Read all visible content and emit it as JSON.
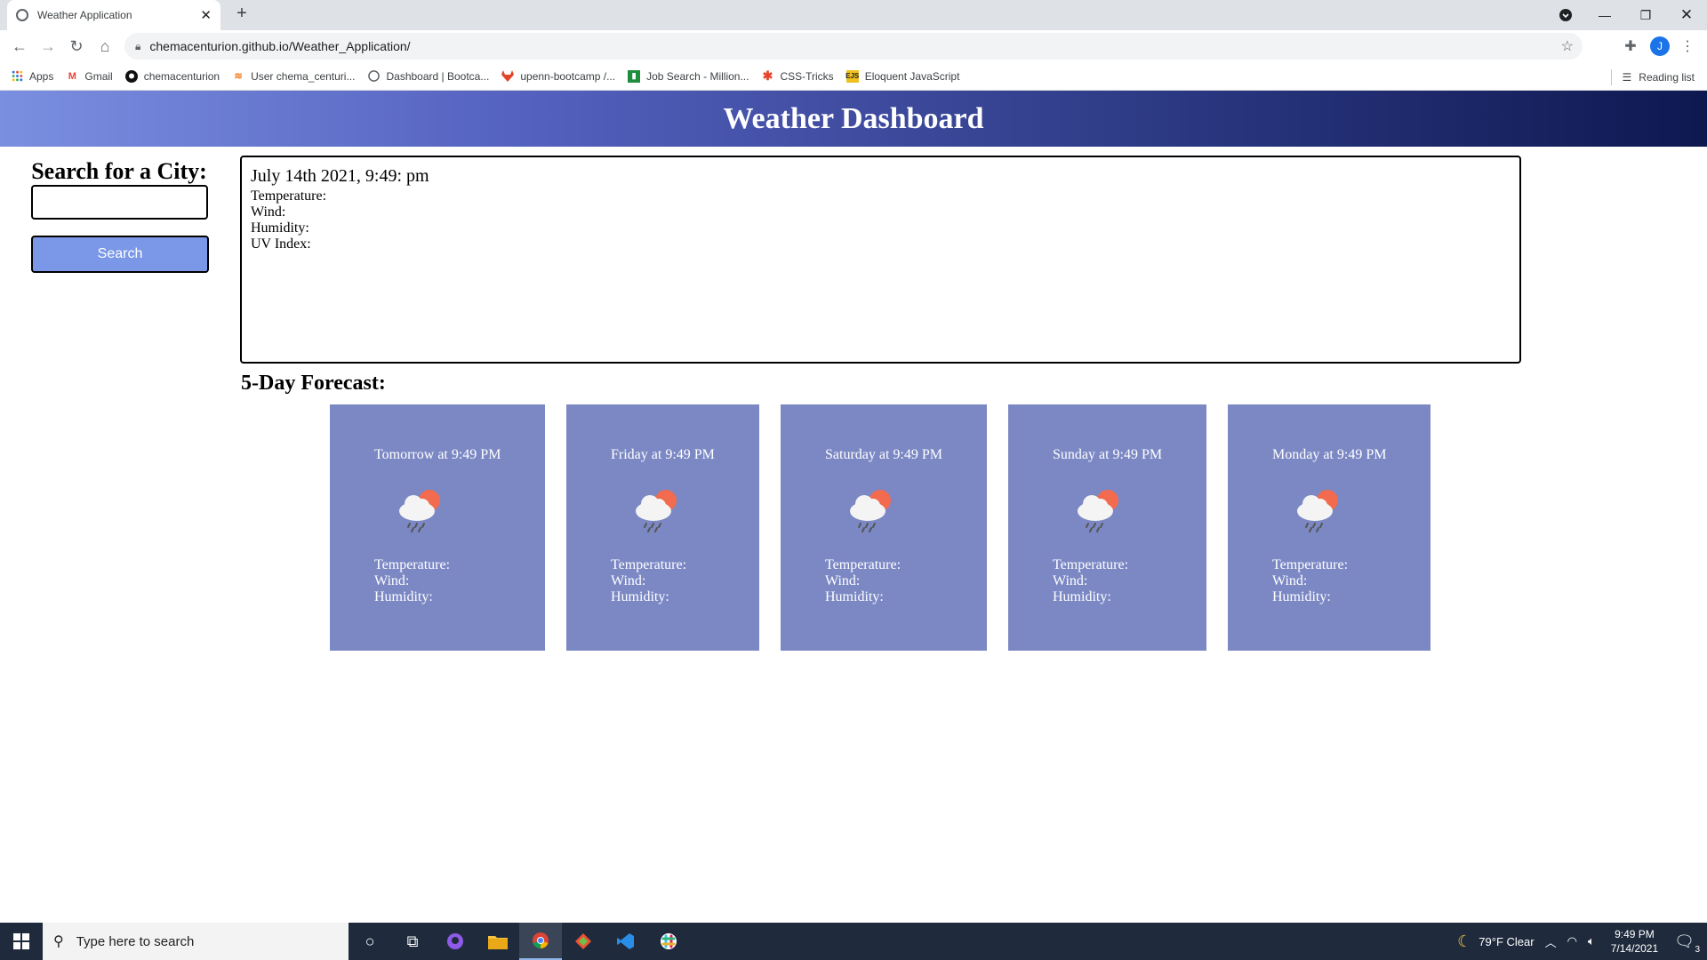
{
  "browser": {
    "tab_title": "Weather Application",
    "url": "chemacenturion.github.io/Weather_Application/",
    "profile_initial": "J",
    "bookmarks": [
      {
        "icon": "apps-grid-icon",
        "label": "Apps"
      },
      {
        "icon": "gmail-icon",
        "label": "Gmail"
      },
      {
        "icon": "github-icon",
        "label": "chemacenturion"
      },
      {
        "icon": "stackoverflow-icon",
        "label": "User chema_centuri..."
      },
      {
        "icon": "globe-icon",
        "label": "Dashboard | Bootca..."
      },
      {
        "icon": "gitlab-icon",
        "label": "upenn-bootcamp /..."
      },
      {
        "icon": "job-search-icon",
        "label": "Job Search - Million..."
      },
      {
        "icon": "css-tricks-icon",
        "label": "CSS-Tricks"
      },
      {
        "icon": "ejs-icon",
        "label": "Eloquent JavaScript"
      }
    ],
    "reading_list": "Reading list"
  },
  "page": {
    "title": "Weather Dashboard",
    "search_title": "Search for a City:",
    "search_input_value": "",
    "search_button": "Search",
    "current": {
      "date": "July 14th 2021, 9:49: pm",
      "temperature_label": "Temperature:",
      "wind_label": "Wind:",
      "humidity_label": "Humidity:",
      "uv_label": "UV Index:"
    },
    "forecast_title": "5-Day Forecast:",
    "forecast": [
      {
        "day": "Tomorrow at 9:49 PM",
        "icon": "cloud-rain-sun-icon",
        "temperature": "Temperature:",
        "wind": "Wind:",
        "humidity": "Humidity:"
      },
      {
        "day": "Friday at 9:49 PM",
        "icon": "cloud-rain-sun-icon",
        "temperature": "Temperature:",
        "wind": "Wind:",
        "humidity": "Humidity:"
      },
      {
        "day": "Saturday at 9:49 PM",
        "icon": "cloud-rain-sun-icon",
        "temperature": "Temperature:",
        "wind": "Wind:",
        "humidity": "Humidity:"
      },
      {
        "day": "Sunday at 9:49 PM",
        "icon": "cloud-rain-sun-icon",
        "temperature": "Temperature:",
        "wind": "Wind:",
        "humidity": "Humidity:"
      },
      {
        "day": "Monday at 9:49 PM",
        "icon": "cloud-rain-sun-icon",
        "temperature": "Temperature:",
        "wind": "Wind:",
        "humidity": "Humidity:"
      }
    ]
  },
  "taskbar": {
    "search_placeholder": "Type here to search",
    "weather": "79°F  Clear",
    "time": "9:49 PM",
    "date": "7/14/2021",
    "notification_count": "3"
  },
  "colors": {
    "header_gradient_start": "#7b8fe0",
    "header_gradient_end": "#0e1850",
    "card_bg": "#7b88c4",
    "search_button_bg": "#7b98e8"
  }
}
